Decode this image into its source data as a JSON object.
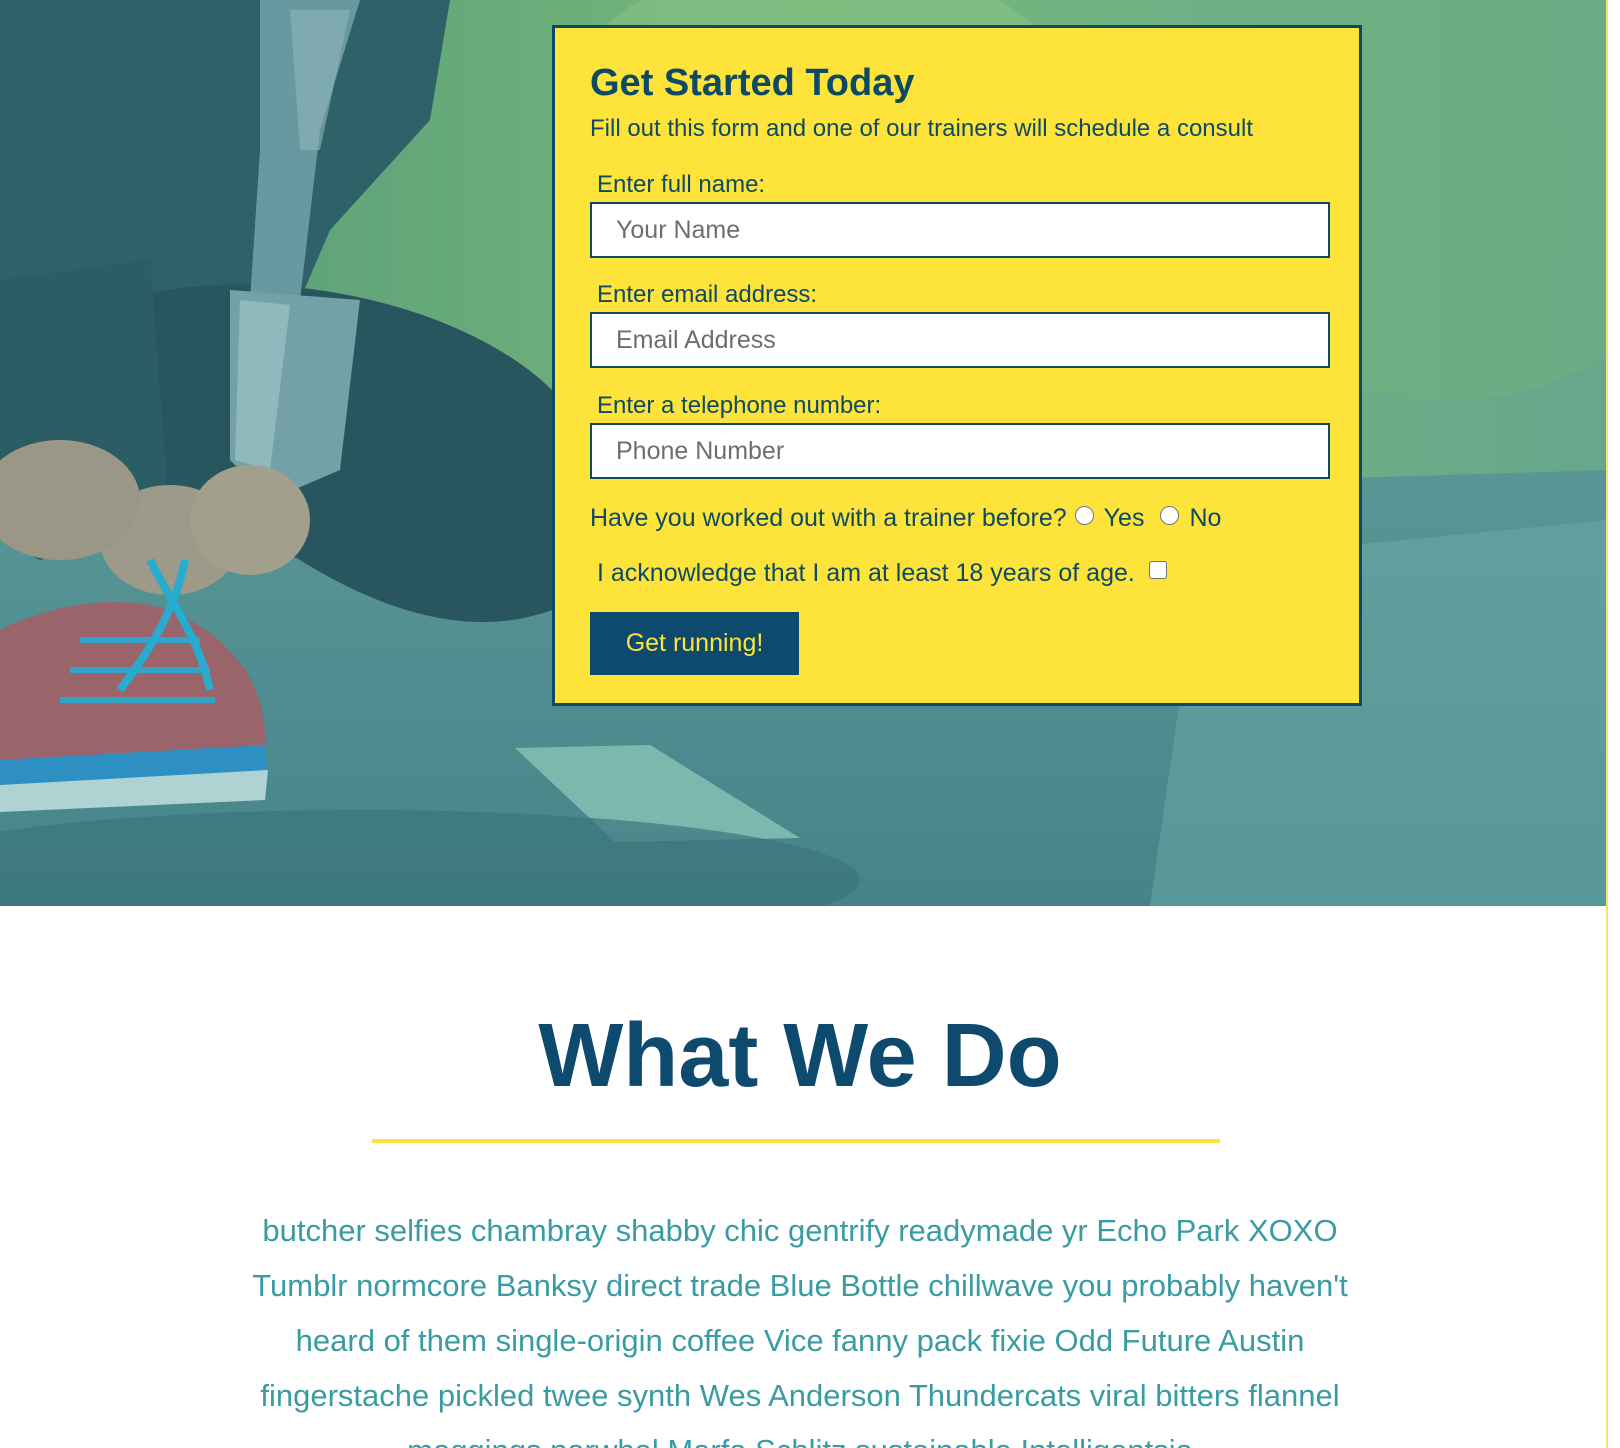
{
  "form": {
    "title": "Get Started Today",
    "subtitle": "Fill out this form and one of our trainers will schedule a consult",
    "name_label": "Enter full name:",
    "name_placeholder": "Your Name",
    "email_label": "Enter email address:",
    "email_placeholder": "Email Address",
    "phone_label": "Enter a telephone number:",
    "phone_placeholder": "Phone Number",
    "trainer_question": "Have you worked out with a trainer before?",
    "option_yes": "Yes",
    "option_no": "No",
    "age_ack": "I acknowledge that I am at least 18 years of age.",
    "submit_label": "Get running!"
  },
  "section": {
    "title": "What We Do",
    "body": "butcher selfies chambray shabby chic gentrify readymade yr Echo Park XOXO Tumblr normcore Banksy direct trade Blue Bottle chillwave you probably haven't heard of them single-origin coffee Vice fanny pack fixie Odd Future Austin fingerstache pickled twee synth Wes Anderson Thundercats viral bitters flannel meggings narwhal Marfa Schlitz sustainable Intelligentsia"
  },
  "colors": {
    "navy": "#0e4a6e",
    "yellow": "#fde33a",
    "teal_text": "#3a9ca3",
    "white": "#ffffff"
  }
}
